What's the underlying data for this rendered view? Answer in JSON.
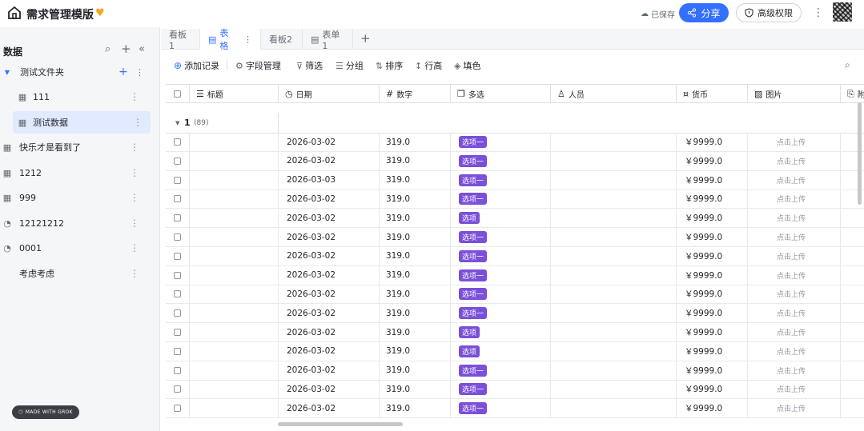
{
  "header": {
    "title": "需求管理模版",
    "saved_status": "已保存",
    "share_label": "分享",
    "permission_label": "高级权限"
  },
  "sidebar": {
    "title": "数据",
    "items": [
      {
        "label": "测试文件夹",
        "icon": "folder-icon"
      },
      {
        "label": "111",
        "icon": "table-icon"
      },
      {
        "label": "测试数据",
        "icon": "table-icon"
      },
      {
        "label": "快乐才是看到了",
        "icon": "table-icon"
      },
      {
        "label": "1212",
        "icon": "table-icon"
      },
      {
        "label": "999",
        "icon": "table-icon"
      },
      {
        "label": "12121212",
        "icon": "dashboard-icon"
      },
      {
        "label": "0001",
        "icon": "dashboard-icon"
      },
      {
        "label": "考虑考虑",
        "icon": "none"
      }
    ],
    "made_with": "MADE WITH GROK"
  },
  "tabs": [
    {
      "label": "看板1"
    },
    {
      "label": "表格"
    },
    {
      "label": "看板2"
    },
    {
      "label": "表单1"
    }
  ],
  "toolbar": {
    "add_record": "添加记录",
    "field_manage": "字段管理",
    "filter": "筛选",
    "group": "分组",
    "sort": "排序",
    "row_height": "行高",
    "fill_color": "填色"
  },
  "table": {
    "columns": [
      "标题",
      "日期",
      "数字",
      "多选",
      "人员",
      "货币",
      "图片",
      "附"
    ],
    "group": {
      "label": "1",
      "count": "(89)"
    },
    "rows": [
      {
        "date": "2026-03-02",
        "number": "319.0",
        "tag": "选项一",
        "currency": "￥9999.0",
        "image": "点击上传"
      },
      {
        "date": "2026-03-02",
        "number": "319.0",
        "tag": "选项一",
        "currency": "￥9999.0",
        "image": "点击上传"
      },
      {
        "date": "2026-03-03",
        "number": "319.0",
        "tag": "选项一",
        "currency": "￥9999.0",
        "image": "点击上传"
      },
      {
        "date": "2026-03-02",
        "number": "319.0",
        "tag": "选项一",
        "currency": "￥9999.0",
        "image": "点击上传"
      },
      {
        "date": "2026-03-02",
        "number": "319.0",
        "tag": "选项",
        "currency": "￥9999.0",
        "image": "点击上传"
      },
      {
        "date": "2026-03-02",
        "number": "319.0",
        "tag": "选项一",
        "currency": "￥9999.0",
        "image": "点击上传"
      },
      {
        "date": "2026-03-02",
        "number": "319.0",
        "tag": "选项一",
        "currency": "￥9999.0",
        "image": "点击上传"
      },
      {
        "date": "2026-03-02",
        "number": "319.0",
        "tag": "选项一",
        "currency": "￥9999.0",
        "image": "点击上传"
      },
      {
        "date": "2026-03-02",
        "number": "319.0",
        "tag": "选项一",
        "currency": "￥9999.0",
        "image": "点击上传"
      },
      {
        "date": "2026-03-02",
        "number": "319.0",
        "tag": "选项一",
        "currency": "￥9999.0",
        "image": "点击上传"
      },
      {
        "date": "2026-03-02",
        "number": "319.0",
        "tag": "选项",
        "currency": "￥9999.0",
        "image": "点击上传"
      },
      {
        "date": "2026-03-02",
        "number": "319.0",
        "tag": "选项",
        "currency": "￥9999.0",
        "image": "点击上传"
      },
      {
        "date": "2026-03-02",
        "number": "319.0",
        "tag": "选项一",
        "currency": "￥9999.0",
        "image": "点击上传"
      },
      {
        "date": "2026-03-02",
        "number": "319.0",
        "tag": "选项一",
        "currency": "￥9999.0",
        "image": "点击上传"
      },
      {
        "date": "2026-03-02",
        "number": "319.0",
        "tag": "选项一",
        "currency": "￥9999.0",
        "image": "点击上传"
      }
    ]
  }
}
